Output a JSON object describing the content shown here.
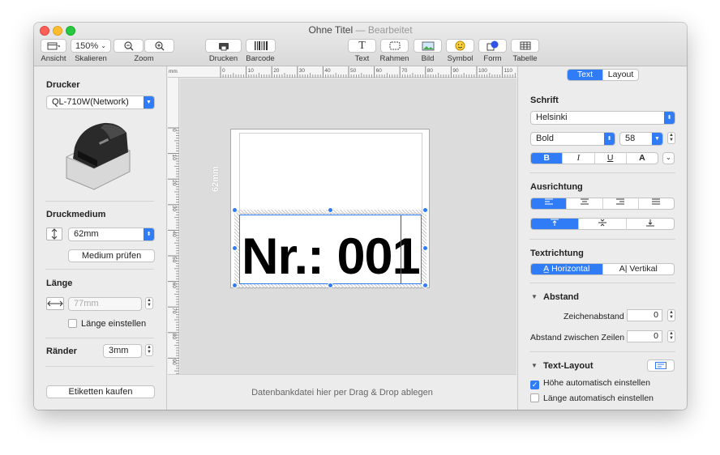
{
  "window": {
    "title": "Ohne Titel",
    "subtitle": "Bearbeitet"
  },
  "toolbar": {
    "ansicht_label": "Ansicht",
    "skalieren_label": "Skalieren",
    "skalieren_value": "150%",
    "zoom_label": "Zoom",
    "drucken_label": "Drucken",
    "barcode_label": "Barcode",
    "text_label": "Text",
    "rahmen_label": "Rahmen",
    "bild_label": "Bild",
    "symbol_label": "Symbol",
    "form_label": "Form",
    "tabelle_label": "Tabelle"
  },
  "left": {
    "drucker_title": "Drucker",
    "printer_value": "QL-710W(Network)",
    "druckmedium_title": "Druckmedium",
    "medium_value": "62mm",
    "medium_check_button": "Medium prüfen",
    "laenge_title": "Länge",
    "laenge_placeholder": "77mm",
    "laenge_einstellen": "Länge einstellen",
    "raender_title": "Ränder",
    "raender_value": "3mm",
    "buy_button": "Etiketten kaufen"
  },
  "canvas": {
    "ruler_unit": "mm",
    "top_ticks": [
      "0",
      "10",
      "20",
      "30",
      "40",
      "50",
      "60",
      "70",
      "80",
      "90",
      "100",
      "110"
    ],
    "left_ticks": [
      "0",
      "10",
      "20",
      "30",
      "40",
      "50",
      "60",
      "70",
      "80",
      "90"
    ],
    "label_height_text": "62mm",
    "label_text": "Nr.: 001",
    "drop_hint": "Datenbankdatei hier per Drag & Drop ablegen"
  },
  "right": {
    "tab_text": "Text",
    "tab_layout": "Layout",
    "schrift_title": "Schrift",
    "font_value": "Helsinki",
    "style_value": "Bold",
    "size_value": "58",
    "bold_label": "B",
    "italic_label": "I",
    "underline_label": "U",
    "outline_label": "A",
    "ausrichtung_title": "Ausrichtung",
    "textrichtung_title": "Textrichtung",
    "horizontal_label": "Horizontal",
    "vertikal_label": "Vertikal",
    "abstand_title": "Abstand",
    "zeichenabstand_label": "Zeichenabstand",
    "zeichenabstand_value": "0",
    "zeilenabstand_label": "Abstand zwischen Zeilen",
    "zeilenabstand_value": "0",
    "textlayout_title": "Text-Layout",
    "hoehe_auto_label": "Höhe automatisch einstellen",
    "laenge_auto_label": "Länge automatisch einstellen"
  },
  "colors": {
    "accent": "#2f7cf6"
  }
}
